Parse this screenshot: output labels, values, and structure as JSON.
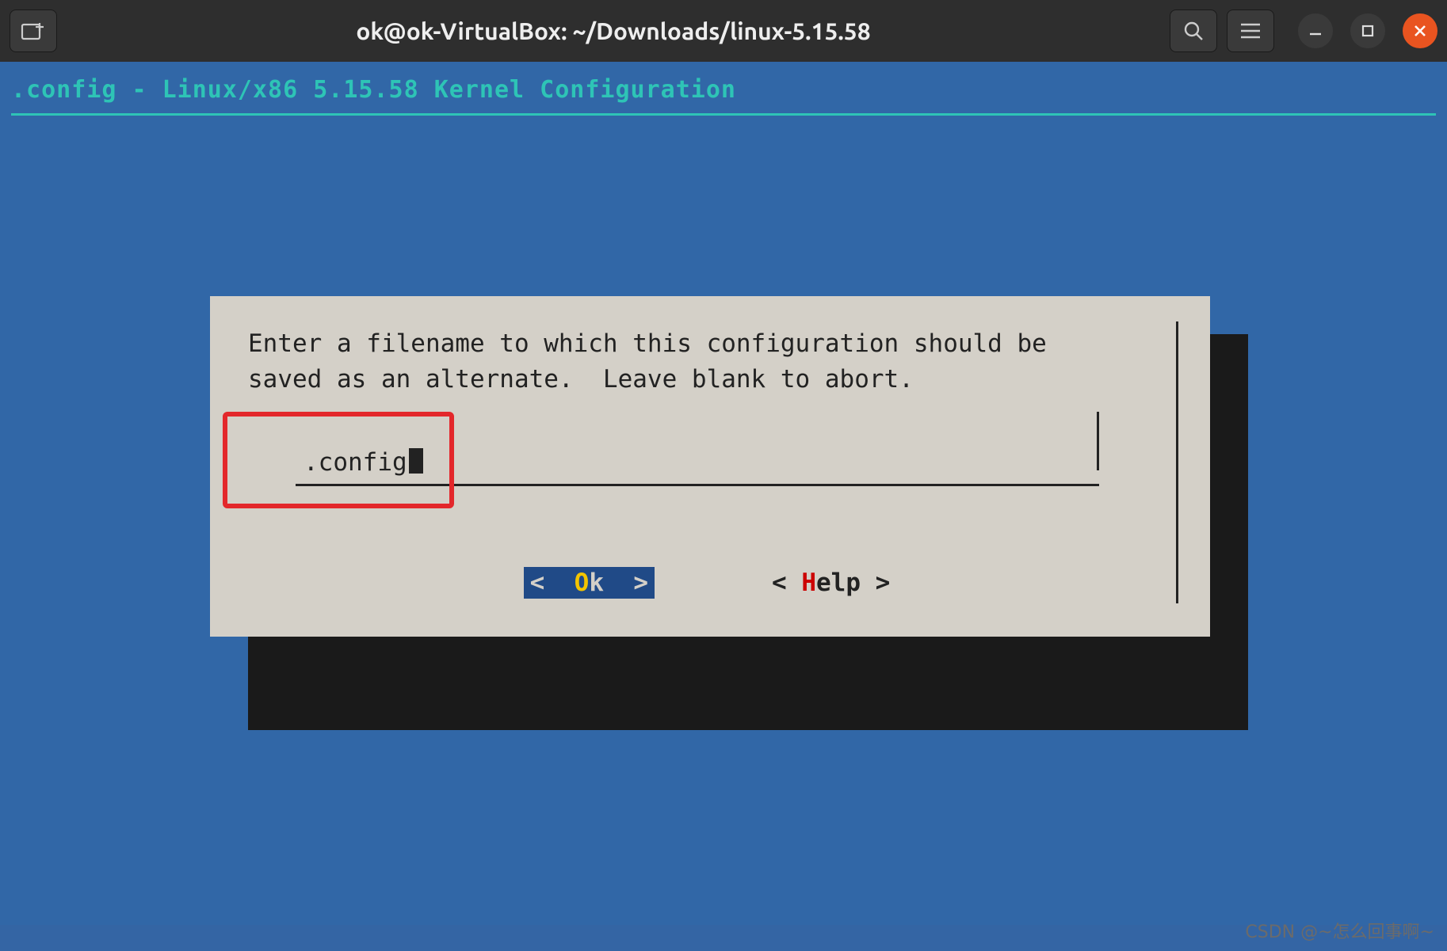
{
  "titlebar": {
    "title": "ok@ok-VirtualBox: ~/Downloads/linux-5.15.58"
  },
  "terminal": {
    "config_header": ".config - Linux/x86 5.15.58 Kernel Configuration"
  },
  "dialog": {
    "prompt": "Enter a filename to which this configuration should be saved as an alternate.  Leave blank to abort.",
    "input_value": ".config",
    "buttons": {
      "ok_left": "<  ",
      "ok_o": "O",
      "ok_rest": "k  >",
      "help_left": "< ",
      "help_h": "H",
      "help_rest": "elp >"
    }
  },
  "watermark": "CSDN @~怎么回事啊~"
}
